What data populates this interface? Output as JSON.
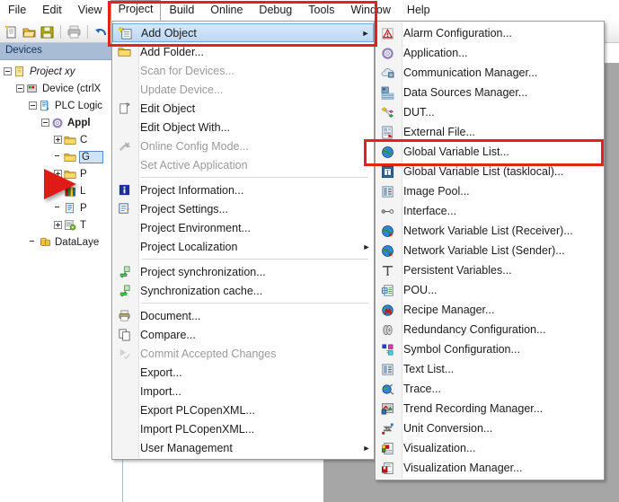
{
  "app": {
    "menubar": [
      {
        "label": "File",
        "active": false
      },
      {
        "label": "Edit",
        "active": false
      },
      {
        "label": "View",
        "active": false
      },
      {
        "label": "Project",
        "active": true
      },
      {
        "label": "Build",
        "active": false
      },
      {
        "label": "Online",
        "active": false
      },
      {
        "label": "Debug",
        "active": false
      },
      {
        "label": "Tools",
        "active": false
      },
      {
        "label": "Window",
        "active": false
      },
      {
        "label": "Help",
        "active": false
      }
    ],
    "toolbar_icons": [
      "new-project-icon",
      "open-project-icon",
      "save-project-icon",
      "print-icon",
      "undo-icon"
    ]
  },
  "devices_panel": {
    "title": "Devices",
    "tree": [
      {
        "label": "Project xy",
        "icon": "project-icon",
        "indent": 0,
        "expander": "minus",
        "italic": true
      },
      {
        "label": "Device (ctrlX",
        "icon": "device-icon",
        "indent": 1,
        "expander": "minus",
        "italic": false
      },
      {
        "label": "PLC Logic",
        "icon": "plc-logic-icon",
        "indent": 2,
        "expander": "minus",
        "italic": false
      },
      {
        "label": "Appl",
        "icon": "application-icon",
        "indent": 3,
        "expander": "minus",
        "bold": true
      },
      {
        "label": "C",
        "icon": "folder-icon",
        "indent": 4,
        "expander": "plus"
      },
      {
        "label": "G",
        "icon": "folder-icon",
        "indent": 4,
        "expander": "none",
        "selected": true
      },
      {
        "label": "P",
        "icon": "folder-icon",
        "indent": 4,
        "expander": "plus"
      },
      {
        "label": "L",
        "icon": "library-manager-icon",
        "indent": 4,
        "expander": "none"
      },
      {
        "label": "P",
        "icon": "pou-doc-icon",
        "indent": 4,
        "expander": "none"
      },
      {
        "label": "T",
        "icon": "task-config-icon",
        "indent": 4,
        "expander": "plus"
      },
      {
        "label": "DataLaye",
        "icon": "datalayer-icon",
        "indent": 2,
        "expander": "none"
      }
    ]
  },
  "project_menu": {
    "items": [
      {
        "label": "Add Object",
        "icon": "add-object-icon",
        "arrow": true,
        "disabled": false,
        "highlighted": true
      },
      {
        "label": "Add Folder...",
        "icon": "folder-icon",
        "arrow": false,
        "disabled": false
      },
      {
        "label": "Scan for Devices...",
        "icon": null,
        "arrow": false,
        "disabled": true
      },
      {
        "label": "Update Device...",
        "icon": null,
        "arrow": false,
        "disabled": true
      },
      {
        "label": "Edit Object",
        "icon": "edit-object-icon",
        "arrow": false,
        "disabled": false
      },
      {
        "label": "Edit Object With...",
        "icon": null,
        "arrow": false,
        "disabled": false
      },
      {
        "label": "Online Config Mode...",
        "icon": "wrench-icon",
        "arrow": false,
        "disabled": true
      },
      {
        "label": "Set Active Application",
        "icon": null,
        "arrow": false,
        "disabled": true
      },
      {
        "separator": true
      },
      {
        "label": "Project Information...",
        "icon": "info-icon",
        "arrow": false,
        "disabled": false
      },
      {
        "label": "Project Settings...",
        "icon": "project-settings-icon",
        "arrow": false,
        "disabled": false
      },
      {
        "label": "Project Environment...",
        "icon": null,
        "arrow": false,
        "disabled": false
      },
      {
        "label": "Project Localization",
        "icon": null,
        "arrow": true,
        "disabled": false
      },
      {
        "separator": true
      },
      {
        "label": "Project synchronization...",
        "icon": "sync-icon",
        "arrow": false,
        "disabled": false
      },
      {
        "label": "Synchronization cache...",
        "icon": "sync-icon",
        "arrow": false,
        "disabled": false
      },
      {
        "separator": true
      },
      {
        "label": "Document...",
        "icon": "printer-icon",
        "arrow": false,
        "disabled": false
      },
      {
        "label": "Compare...",
        "icon": "compare-icon",
        "arrow": false,
        "disabled": false
      },
      {
        "label": "Commit Accepted Changes",
        "icon": "commit-icon",
        "arrow": false,
        "disabled": true
      },
      {
        "label": "Export...",
        "icon": null,
        "arrow": false,
        "disabled": false
      },
      {
        "label": "Import...",
        "icon": null,
        "arrow": false,
        "disabled": false
      },
      {
        "label": "Export PLCopenXML...",
        "icon": null,
        "arrow": false,
        "disabled": false
      },
      {
        "label": "Import PLCopenXML...",
        "icon": null,
        "arrow": false,
        "disabled": false
      },
      {
        "label": "User Management",
        "icon": null,
        "arrow": true,
        "disabled": false
      }
    ]
  },
  "add_object_menu": {
    "items": [
      {
        "label": "Alarm Configuration...",
        "icon": "alarm-config-icon"
      },
      {
        "label": "Application...",
        "icon": "application-icon"
      },
      {
        "label": "Communication Manager...",
        "icon": "communication-manager-icon"
      },
      {
        "label": "Data Sources Manager...",
        "icon": "data-sources-manager-icon"
      },
      {
        "label": "DUT...",
        "icon": "dut-icon"
      },
      {
        "label": "External File...",
        "icon": "external-file-icon"
      },
      {
        "label": "Global Variable List...",
        "icon": "global-variable-list-icon",
        "annotated": true
      },
      {
        "label": "Global Variable List (tasklocal)...",
        "icon": "gvl-tasklocal-icon"
      },
      {
        "label": "Image Pool...",
        "icon": "image-pool-icon"
      },
      {
        "label": "Interface...",
        "icon": "interface-icon"
      },
      {
        "label": "Network Variable List (Receiver)...",
        "icon": "network-variable-list-icon"
      },
      {
        "label": "Network Variable List (Sender)...",
        "icon": "network-variable-list-icon"
      },
      {
        "label": "Persistent Variables...",
        "icon": "persistent-variables-icon"
      },
      {
        "label": "POU...",
        "icon": "pou-icon"
      },
      {
        "label": "Recipe Manager...",
        "icon": "recipe-manager-icon"
      },
      {
        "label": "Redundancy Configuration...",
        "icon": "redundancy-config-icon"
      },
      {
        "label": "Symbol Configuration...",
        "icon": "symbol-config-icon"
      },
      {
        "label": "Text List...",
        "icon": "text-list-icon"
      },
      {
        "label": "Trace...",
        "icon": "trace-icon"
      },
      {
        "label": "Trend Recording Manager...",
        "icon": "trend-recording-icon"
      },
      {
        "label": "Unit Conversion...",
        "icon": "unit-conversion-icon"
      },
      {
        "label": "Visualization...",
        "icon": "visualization-icon"
      },
      {
        "label": "Visualization Manager...",
        "icon": "visualization-manager-icon"
      }
    ]
  },
  "annotations": {
    "color": "#e2231a",
    "boxes": [
      {
        "name": "project-add-object-highlight"
      },
      {
        "name": "global-variable-list-highlight"
      }
    ],
    "pointer": {
      "name": "red-arrow-pointer",
      "color": "#e01b17"
    }
  }
}
